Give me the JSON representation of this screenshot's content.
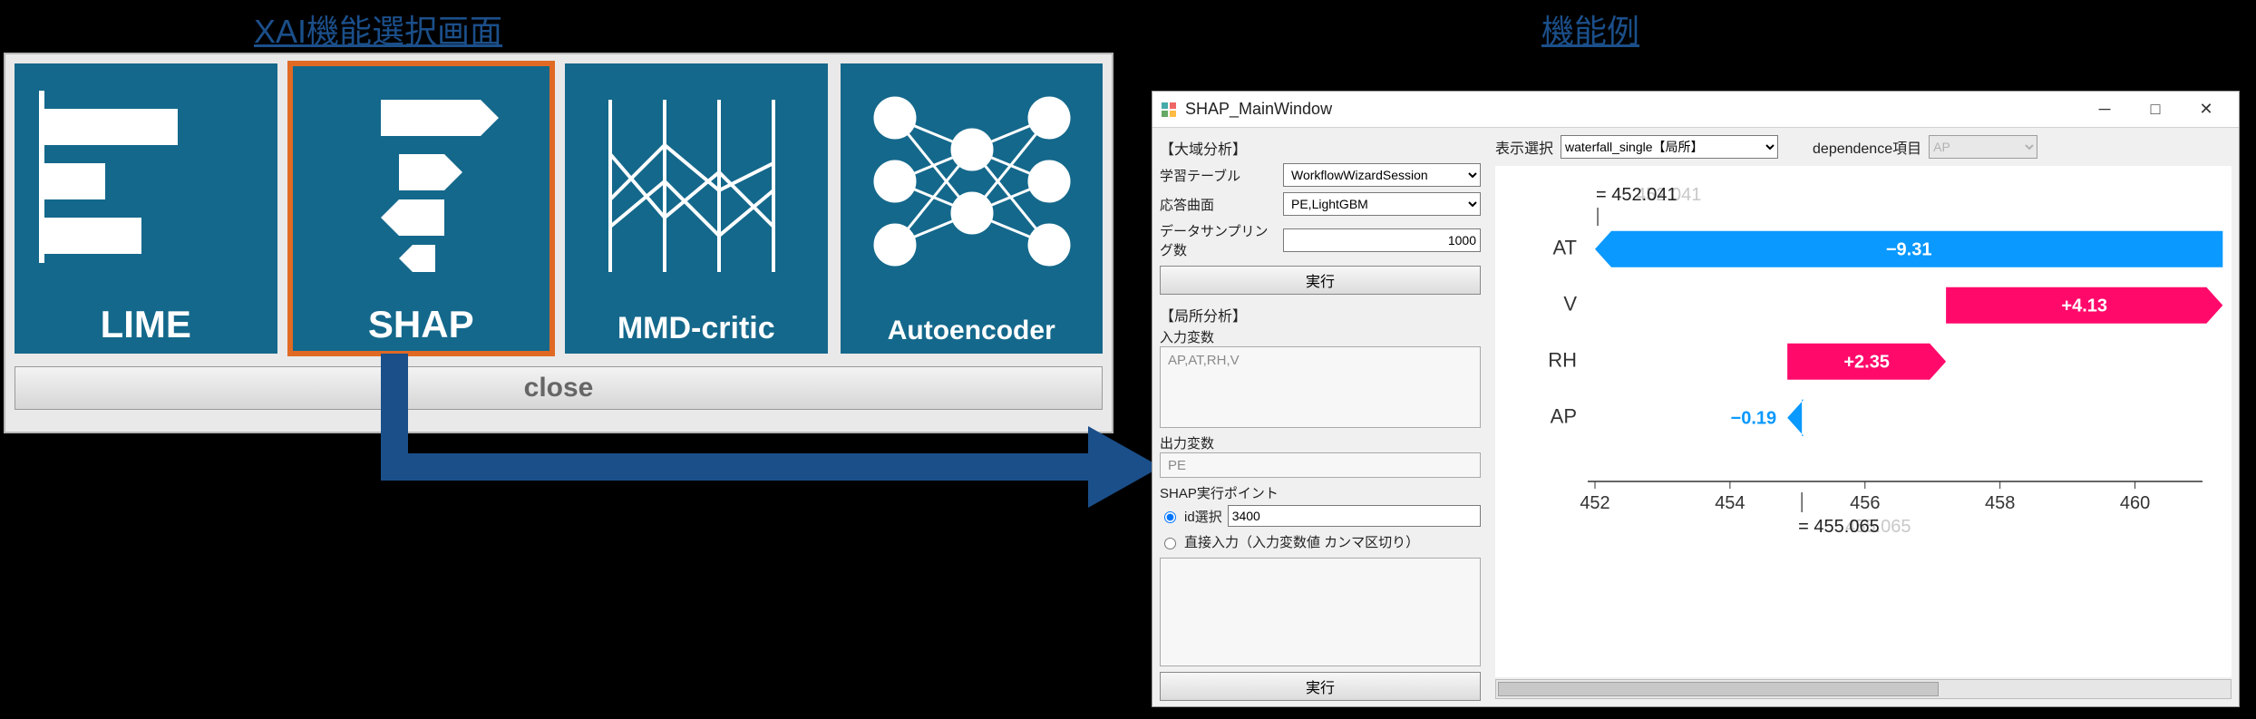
{
  "headings": {
    "left": "XAI機能選択画面",
    "right": "機能例"
  },
  "xai_panel": {
    "tiles": [
      {
        "id": "lime",
        "label": "LIME",
        "selected": false
      },
      {
        "id": "shap",
        "label": "SHAP",
        "selected": true
      },
      {
        "id": "mmd",
        "label": "MMD-critic",
        "selected": false
      },
      {
        "id": "ae",
        "label": "Autoencoder",
        "selected": false
      }
    ],
    "close_label": "close"
  },
  "shap_window": {
    "title": "SHAP_MainWindow",
    "left": {
      "global_section": "【大域分析】",
      "learning_table_label": "学習テーブル",
      "learning_table_value": "WorkflowWizardSession",
      "response_curve_label": "応答曲面",
      "response_curve_value": "PE,LightGBM",
      "sampling_label": "データサンプリング数",
      "sampling_value": "1000",
      "run_label": "実行",
      "local_section": "【局所分析】",
      "input_vars_label": "入力変数",
      "input_vars_value": "AP,AT,RH,V",
      "output_vars_label": "出力変数",
      "output_vars_value": "PE",
      "shap_point_label": "SHAP実行ポイント",
      "radio_id_label": "id選択",
      "radio_id_value": "3400",
      "radio_direct_label": "直接入力（入力変数値 カンマ区切り）",
      "run2_label": "実行"
    },
    "top_controls": {
      "display_select_label": "表示選択",
      "display_select_value": "waterfall_single【局所】",
      "dependence_label": "dependence項目",
      "dependence_value": "AP"
    }
  },
  "chart_data": {
    "type": "bar",
    "title": "",
    "xlabel": "",
    "ylabel": "",
    "xlim": [
      452,
      461
    ],
    "base_value": 455.065,
    "final_value": 452.041,
    "top_label": "= 452.041",
    "bottom_label": "= 455.065",
    "x_ticks": [
      452,
      454,
      456,
      458,
      460
    ],
    "features": [
      {
        "name": "AT",
        "value": -9.31,
        "start": 461.3,
        "end": 452.0,
        "color": "#0a99ff"
      },
      {
        "name": "V",
        "value": 4.13,
        "start": 457.2,
        "end": 461.3,
        "color": "#ff0a6b"
      },
      {
        "name": "RH",
        "value": 2.35,
        "start": 454.85,
        "end": 457.2,
        "color": "#ff0a6b"
      },
      {
        "name": "AP",
        "value": -0.19,
        "start": 455.065,
        "end": 454.85,
        "color": "#0a99ff"
      }
    ]
  },
  "colors": {
    "tile_bg": "#14688b",
    "select_outline": "#e06a24",
    "arrow": "#1b4f8a",
    "pos": "#ff0a6b",
    "neg": "#0a99ff"
  }
}
